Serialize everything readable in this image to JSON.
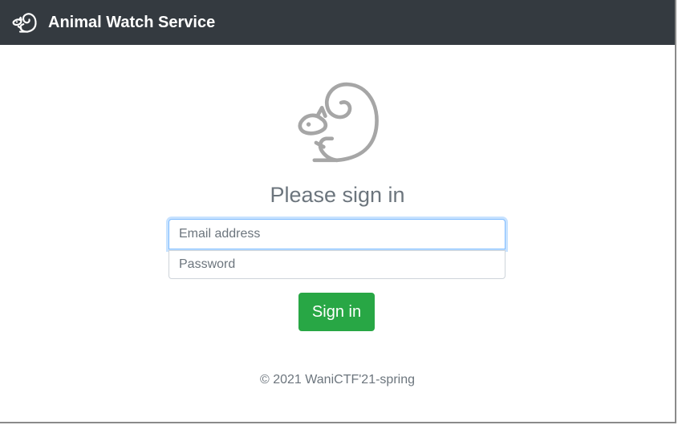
{
  "navbar": {
    "title": "Animal Watch Service",
    "icon": "squirrel-icon"
  },
  "main": {
    "icon": "squirrel-icon",
    "heading": "Please sign in",
    "email_placeholder": "Email address",
    "email_value": "",
    "password_placeholder": "Password",
    "password_value": "",
    "signin_label": "Sign in"
  },
  "footer": {
    "text": "© 2021 WaniCTF'21-spring"
  },
  "colors": {
    "navbar_bg": "#343a40",
    "button_bg": "#28a745",
    "muted_text": "#6c757d",
    "focus_border": "#80bdff"
  }
}
